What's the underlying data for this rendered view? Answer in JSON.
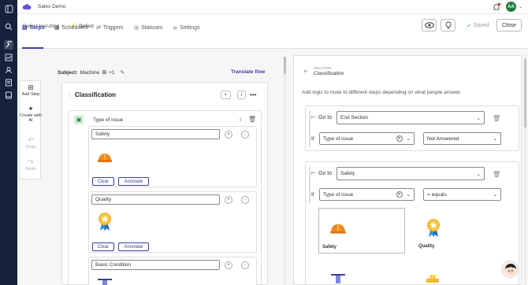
{
  "app": {
    "name": "Sales Demo",
    "user_initials": "AA"
  },
  "breadcrumb": {
    "parent": "Defect Handling",
    "sep": "/",
    "current": "Defect"
  },
  "tabs": [
    {
      "label": "Steps"
    },
    {
      "label": "Schedules"
    },
    {
      "label": "Triggers"
    },
    {
      "label": "Statuses"
    },
    {
      "label": "Settings"
    }
  ],
  "header_actions": {
    "saved": "Saved",
    "close": "Close"
  },
  "tools": [
    {
      "label": "Add Step"
    },
    {
      "label": "Create with AI"
    },
    {
      "label": "Undo"
    },
    {
      "label": "Redo"
    }
  ],
  "subject": {
    "label": "Subject:",
    "value": "Machine",
    "extra": "+1",
    "translate": "Translate flow"
  },
  "section": {
    "title": "Classification"
  },
  "question": {
    "title": "Type of issue"
  },
  "options": [
    {
      "label": "Safety",
      "clear": "Clear",
      "annotate": "Annotate"
    },
    {
      "label": "Quality",
      "clear": "Clear",
      "annotate": "Annotate"
    },
    {
      "label": "Basic Condition"
    }
  ],
  "panel": {
    "kind": "ROUTING",
    "title": "Classification",
    "description": "Add logic to route to different steps depending on what people answer.",
    "rules": [
      {
        "goto_label": "Go to",
        "target": "End Section",
        "if_label": "If",
        "field": "Type of issue",
        "condition": "Not Answered"
      },
      {
        "goto_label": "Go to",
        "target": "Safety",
        "if_label": "If",
        "field": "Type of issue",
        "condition": "= equals"
      }
    ],
    "value_options": [
      {
        "label": "Safety",
        "selected": true
      },
      {
        "label": "Quality",
        "selected": false
      }
    ]
  },
  "colors": {
    "rail": "#16213b",
    "accent": "#3a3fa0",
    "avatar": "#1e7a3c",
    "saved": "#3aa35b"
  }
}
